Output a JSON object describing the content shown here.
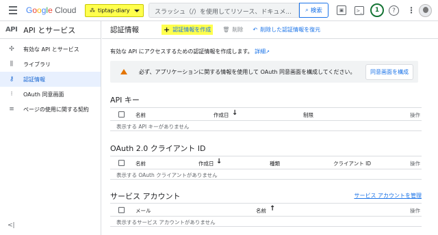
{
  "header": {
    "logo_google": [
      "G",
      "o",
      "o",
      "g",
      "l",
      "e"
    ],
    "logo_cloud": "Cloud",
    "project": "tiptap-diary",
    "search_placeholder": "スラッシュ（/）を使用してリソース、ドキュメ...",
    "search_button": "検索",
    "notifications_count": "1"
  },
  "sidebar": {
    "section_badge": "API",
    "section_title": "API とサービス",
    "items": [
      {
        "label": "有効な API とサービス",
        "icon": "grid-icon"
      },
      {
        "label": "ライブラリ",
        "icon": "library-icon"
      },
      {
        "label": "認証情報",
        "icon": "key-icon"
      },
      {
        "label": "OAuth 同意画面",
        "icon": "consent-icon"
      },
      {
        "label": "ページの使用に関する契約",
        "icon": "agreement-icon"
      }
    ],
    "collapse_label": "<|"
  },
  "toolbar": {
    "title": "認証情報",
    "create_label": "認証情報を作成",
    "delete_label": "削除",
    "restore_label": "削除した認証情報を復元"
  },
  "intro": {
    "text": "有効な API にアクセスするための認証情報を作成します。",
    "link": "詳細"
  },
  "warning": {
    "message": "必ず、アプリケーションに関する情報を使用して OAuth 同意画面を構成してください。",
    "button": "同意画面を構成"
  },
  "api_keys": {
    "title": "API キー",
    "headers": [
      "名前",
      "作成日",
      "制限",
      "操作"
    ],
    "empty": "表示する API キーがありません"
  },
  "oauth": {
    "title": "OAuth 2.0 クライアント ID",
    "headers": [
      "名前",
      "作成日",
      "種類",
      "クライアント ID",
      "操作"
    ],
    "empty": "表示する OAuth クライアントがありません"
  },
  "service_accounts": {
    "title": "サービス アカウント",
    "manage_link": "サービス アカウントを管理",
    "headers": [
      "メール",
      "名前",
      "操作"
    ],
    "empty": "表示するサービス アカウントがありません"
  },
  "colors": {
    "highlight": "#ffff4d",
    "accent": "#1a73e8",
    "warning": "#e37400"
  }
}
